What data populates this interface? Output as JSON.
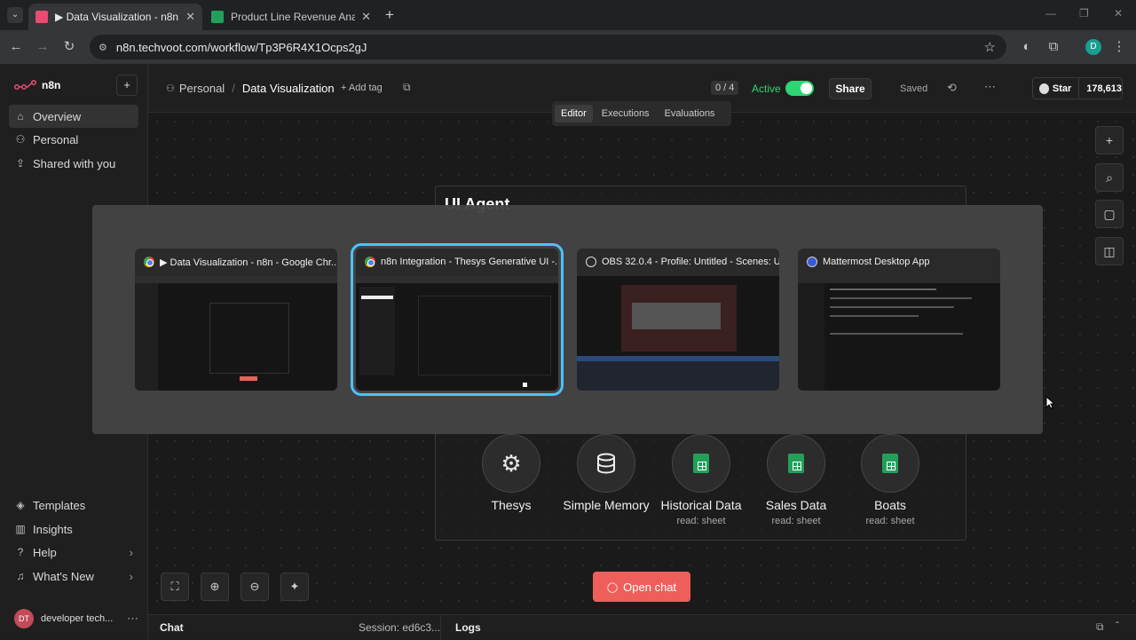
{
  "browser": {
    "tabs": [
      {
        "label": "▶ Data Visualization - n8n",
        "active": true
      },
      {
        "label": "Product Line Revenue Analysis",
        "active": false
      }
    ],
    "url": "n8n.techvoot.com/workflow/Tp3P6R4X1Ocps2gJ",
    "profile_initial": "D"
  },
  "sidebar": {
    "logo": "n8n",
    "top_items": [
      {
        "label": "Overview",
        "icon": "home-icon"
      },
      {
        "label": "Personal",
        "icon": "user-icon"
      },
      {
        "label": "Shared with you",
        "icon": "share-icon"
      }
    ],
    "bottom_items": [
      {
        "label": "Templates",
        "icon": "templates-icon"
      },
      {
        "label": "Insights",
        "icon": "chart-icon"
      },
      {
        "label": "Help",
        "icon": "help-icon"
      },
      {
        "label": "What's New",
        "icon": "bell-icon"
      }
    ],
    "user": {
      "initials": "DT",
      "name": "developer tech..."
    }
  },
  "header": {
    "project": "Personal",
    "workflow": "Data Visualization",
    "add_tag": "+ Add tag",
    "counter": "0 / 4",
    "active_label": "Active",
    "share": "Share",
    "saved": "Saved",
    "github": {
      "star": "Star",
      "count": "178,613"
    },
    "tabs": [
      "Editor",
      "Executions",
      "Evaluations"
    ]
  },
  "canvas": {
    "agent_title": "UI Agent",
    "nodes": [
      {
        "title": "Thesys",
        "sub": "",
        "icon": "openai-icon"
      },
      {
        "title": "Simple Memory",
        "sub": "",
        "icon": "database-icon"
      },
      {
        "title": "Historical Data",
        "sub": "read: sheet",
        "icon": "sheets-icon"
      },
      {
        "title": "Sales Data",
        "sub": "read: sheet",
        "icon": "sheets-icon"
      },
      {
        "title": "Boats",
        "sub": "read: sheet",
        "icon": "sheets-icon"
      }
    ],
    "open_chat": "Open chat"
  },
  "bottombar": {
    "chat": "Chat",
    "session": "Session: ed6c3...",
    "logs": "Logs"
  },
  "switcher": {
    "windows": [
      {
        "title": "▶ Data Visualization - n8n - Google Chr...",
        "icon": "chrome-icon"
      },
      {
        "title": "n8n Integration - Thesys Generative UI -...",
        "icon": "chrome-icon"
      },
      {
        "title": "OBS 32.0.4 - Profile: Untitled - Scenes: U...",
        "icon": "obs-icon"
      },
      {
        "title": "Mattermost Desktop App",
        "icon": "mattermost-icon"
      }
    ],
    "selected_index": 1
  },
  "colors": {
    "accent": "#ea4b71",
    "active_toggle": "#2ed573",
    "selection": "#4cc2ff",
    "open_chat": "#ee5f5b"
  }
}
